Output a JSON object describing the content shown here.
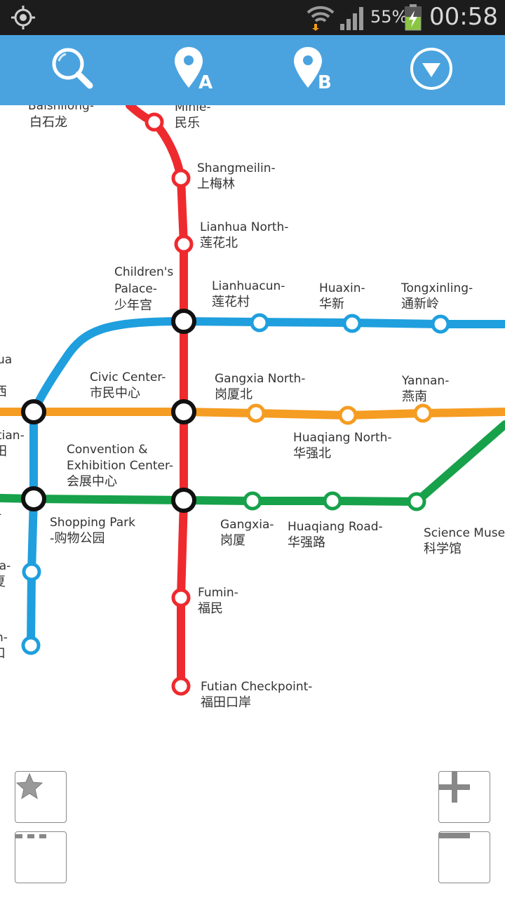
{
  "status_bar": {
    "battery_percent": "55%",
    "time": "00:58",
    "icons": [
      "gps-icon",
      "wifi-icon",
      "signal-icon",
      "battery-charging-icon"
    ]
  },
  "toolbar": {
    "search_icon": "search-icon",
    "point_a_label": "A",
    "point_b_label": "B",
    "menu_icon": "dropdown-circle-icon"
  },
  "colors": {
    "toolbar": "#4aa3df",
    "line_red": "#ee2a2e",
    "line_blue": "#1f9fde",
    "line_orange": "#f59c22",
    "line_green": "#17a14a",
    "transfer": "#111111"
  },
  "map": {
    "stations": {
      "baishilong": {
        "en": "Baishilong-",
        "cn": "白石龙"
      },
      "minle": {
        "en": "Minle-",
        "cn": "民乐"
      },
      "shangmeilin": {
        "en": "Shangmeilin-",
        "cn": "上梅林"
      },
      "lianhua_north": {
        "en": "Lianhua North-",
        "cn": "莲花北"
      },
      "childrens_palace": {
        "en1": "Children's",
        "en2": "Palace-",
        "cn": "少年宫"
      },
      "lianhuacun": {
        "en": "Lianhuacun-",
        "cn": "莲花村"
      },
      "huaxin": {
        "en": "Huaxin-",
        "cn": "华新"
      },
      "tongxinling": {
        "en": "Tongxinling-",
        "cn": "通新岭"
      },
      "left_a": {
        "en": "ua",
        "cn": "西"
      },
      "civic_center": {
        "en": "Civic Center-",
        "cn": "市民中心"
      },
      "gangxia_north": {
        "en": "Gangxia North-",
        "cn": "岗厦北"
      },
      "yannan": {
        "en": "Yannan-",
        "cn": "燕南"
      },
      "left_b": {
        "en": "tian-",
        "cn": "田"
      },
      "huaqiang_north": {
        "en": "Huaqiang North-",
        "cn": "华强北"
      },
      "convention": {
        "en1": "Convention &",
        "en2": "Exhibition Center-",
        "cn": "会展中心"
      },
      "left_c": {
        "en": "-"
      },
      "shopping_park": {
        "en": "Shopping Park",
        "cn": "-购物公园"
      },
      "gangxia": {
        "en": "Gangxia-",
        "cn": "岗厦"
      },
      "huaqiang_road": {
        "en": "Huaqiang Road-",
        "cn": "华强路"
      },
      "science_museum": {
        "en": "Science Muse",
        "cn": "科学馆"
      },
      "left_d": {
        "en": "ia-",
        "cn": "夏"
      },
      "fumin": {
        "en": "Fumin-",
        "cn": "福民"
      },
      "left_e": {
        "en": "n-",
        "cn": "口"
      },
      "futian_checkpoint": {
        "en": "Futian Checkpoint-",
        "cn": "福田口岸"
      }
    }
  },
  "controls": {
    "favorite_icon": "star-icon",
    "more_icon": "more-icon",
    "zoom_in_icon": "plus-icon",
    "zoom_out_icon": "minus-icon"
  }
}
